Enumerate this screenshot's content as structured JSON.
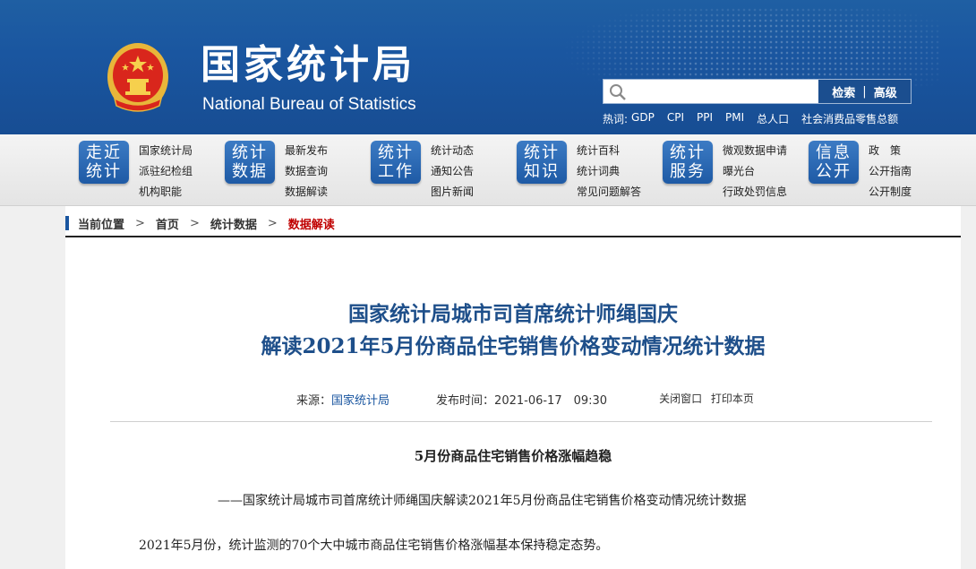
{
  "header": {
    "logo_cn": "国家统计局",
    "logo_en": "National Bureau of Statistics",
    "search": {
      "placeholder": "",
      "search_label": "检索",
      "separator": "|",
      "advanced_label": "高级"
    },
    "hotwords": {
      "label": "热词:",
      "items": [
        "GDP",
        "CPI",
        "PPI",
        "PMI",
        "总人口",
        "社会消费品零售总额"
      ]
    },
    "colors": {
      "header_blue": "#1a56a0",
      "nav_badge_blue": "#2563ad"
    }
  },
  "nav": [
    {
      "badge_line1": "走近",
      "badge_line2": "统计",
      "links": [
        "国家统计局",
        "派驻纪检组",
        "机构职能"
      ]
    },
    {
      "badge_line1": "统计",
      "badge_line2": "数据",
      "links": [
        "最新发布",
        "数据查询",
        "数据解读"
      ]
    },
    {
      "badge_line1": "统计",
      "badge_line2": "工作",
      "links": [
        "统计动态",
        "通知公告",
        "图片新闻"
      ]
    },
    {
      "badge_line1": "统计",
      "badge_line2": "知识",
      "links": [
        "统计百科",
        "统计词典",
        "常见问题解答"
      ]
    },
    {
      "badge_line1": "统计",
      "badge_line2": "服务",
      "links": [
        "微观数据申请",
        "曝光台",
        "行政处罚信息"
      ]
    },
    {
      "badge_line1": "信息",
      "badge_line2": "公开",
      "links": [
        "政　策",
        "公开指南",
        "公开制度"
      ]
    }
  ],
  "breadcrumb": {
    "label": "当前位置",
    "arrow": ">",
    "items": [
      "首页",
      "统计数据"
    ],
    "current": "数据解读",
    "current_color": "#c00000"
  },
  "article": {
    "title_line1": "国家统计局城市司首席统计师绳国庆",
    "title_line2": "解读2021年5月份商品住宅销售价格变动情况统计数据",
    "source_label": "来源：",
    "source_value": "国家统计局",
    "publish_label": "发布时间：",
    "publish_time": "2021-06-17　09:30",
    "close_window": "关闭窗口",
    "print_page": "打印本页",
    "subhead": "5月份商品住宅销售价格涨幅趋稳",
    "paragraphs": [
      "——国家统计局城市司首席统计师绳国庆解读2021年5月份商品住宅销售价格变动情况统计数据",
      "2021年5月份，统计监测的70个大中城市商品住宅销售价格涨幅基本保持稳定态势。"
    ]
  }
}
